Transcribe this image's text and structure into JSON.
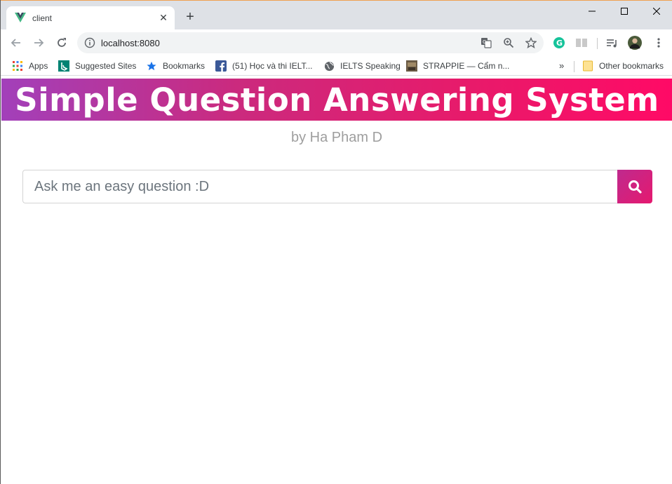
{
  "browser": {
    "tab": {
      "title": "client",
      "close_glyph": "✕",
      "favicon": "vue-icon"
    },
    "new_tab_glyph": "+",
    "url": "localhost:8080",
    "bookmarks": [
      {
        "label": "Apps",
        "icon": "apps-grid-icon"
      },
      {
        "label": "Suggested Sites",
        "icon": "bing-icon"
      },
      {
        "label": "Bookmarks",
        "icon": "star-icon"
      },
      {
        "label": "(51) Học và thi IELT...",
        "icon": "facebook-icon"
      },
      {
        "label": "IELTS Speaking",
        "icon": "globe-icon"
      },
      {
        "label": "STRAPPIE — Cẩm n...",
        "icon": "thumbnail-icon"
      }
    ],
    "more_glyph": "»",
    "other_bookmarks": "Other bookmarks"
  },
  "page": {
    "title": "Simple Question Answering System",
    "byline": "by Ha Pham D",
    "search": {
      "placeholder": "Ask me an easy question :D",
      "value": ""
    }
  },
  "colors": {
    "hero_start": "#a240ba",
    "hero_end": "#ff0a66",
    "byline": "#9e9e9e",
    "search_button": "#d4217d"
  }
}
